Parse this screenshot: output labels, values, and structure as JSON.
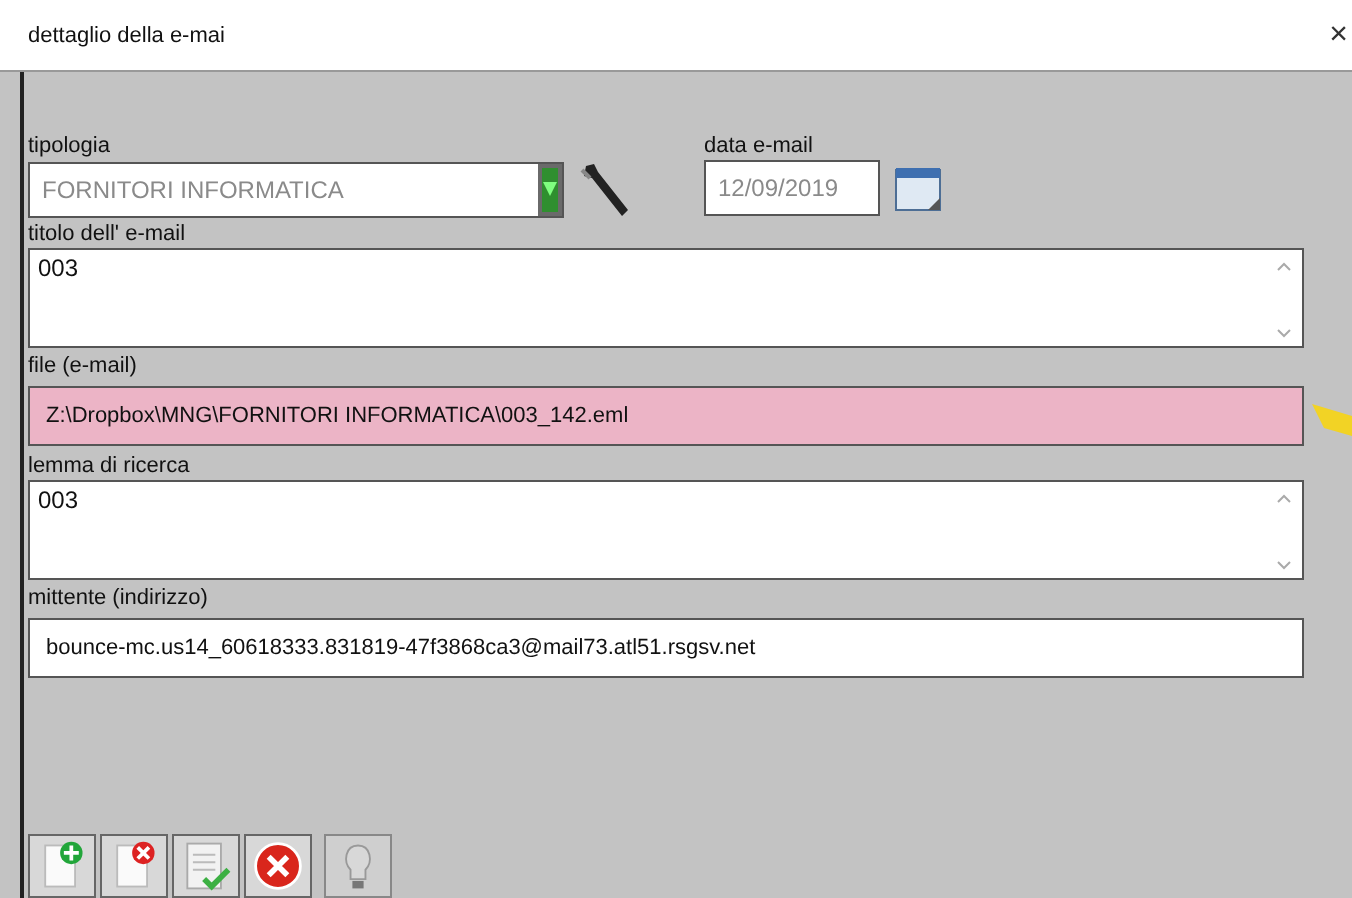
{
  "window": {
    "title": "dettaglio della e-mai",
    "close": "×"
  },
  "tipologia": {
    "label": "tipologia",
    "value": "FORNITORI INFORMATICA",
    "disabled": true
  },
  "data_email": {
    "label": "data e-mail",
    "value": "12/09/2019",
    "disabled": true
  },
  "fields": [
    {
      "kind": "textarea",
      "label": "titolo dell' e-mail",
      "value": "003",
      "highlighted": false
    },
    {
      "kind": "input",
      "label": "file (e-mail)",
      "value": "Z:\\Dropbox\\MNG\\FORNITORI INFORMATICA\\003_142.eml",
      "highlighted": true
    },
    {
      "kind": "textarea",
      "label": "lemma di ricerca",
      "value": "003",
      "highlighted": false
    },
    {
      "kind": "input",
      "label": "mittente (indirizzo)",
      "value": "bounce-mc.us14_60618333.831819-47f3868ca3@mail73.atl51.rsgsv.net",
      "highlighted": false
    }
  ],
  "buttons": [
    {
      "kind": "add",
      "disabled": false
    },
    {
      "kind": "remove",
      "disabled": false
    },
    {
      "kind": "confirm",
      "disabled": false
    },
    {
      "kind": "cancel",
      "disabled": false
    },
    {
      "kind": "bulb",
      "disabled": true
    }
  ]
}
